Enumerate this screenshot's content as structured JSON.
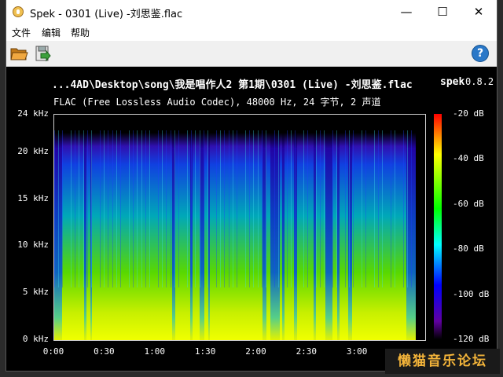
{
  "window": {
    "title": "Spek - 0301 (Live) -刘思鉴.flac",
    "controls": {
      "minimize": "—",
      "maximize": "☐",
      "close": "✕"
    }
  },
  "menu": [
    "文件",
    "编辑",
    "帮助"
  ],
  "toolbar": {
    "open_icon": "folder-open-icon",
    "save_icon": "save-icon",
    "help_label": "?"
  },
  "content": {
    "file_title": "...4AD\\Desktop\\song\\我是唱作人2 第1期\\0301 (Live) -刘思鉴.flac",
    "app_name": "spek",
    "version": "0.8.2",
    "file_info": "FLAC (Free Lossless Audio Codec), 48000 Hz, 24 字节, 2 声道"
  },
  "freq_labels": [
    {
      "label": "24 kHz",
      "value": 24
    },
    {
      "label": "20 kHz",
      "value": 20
    },
    {
      "label": "15 kHz",
      "value": 15
    },
    {
      "label": "10 kHz",
      "value": 10
    },
    {
      "label": "5 kHz",
      "value": 5
    },
    {
      "label": "0 kHz",
      "value": 0
    }
  ],
  "time_labels": [
    {
      "label": "0:00",
      "seconds": 0
    },
    {
      "label": "0:30",
      "seconds": 30
    },
    {
      "label": "1:00",
      "seconds": 60
    },
    {
      "label": "1:30",
      "seconds": 90
    },
    {
      "label": "2:00",
      "seconds": 120
    },
    {
      "label": "2:30",
      "seconds": 150
    },
    {
      "label": "3:00",
      "seconds": 180
    }
  ],
  "time_axis_max_seconds": 220,
  "db_labels": [
    {
      "label": "-20 dB",
      "value": -20
    },
    {
      "label": "-40 dB",
      "value": -40
    },
    {
      "label": "-60 dB",
      "value": -60
    },
    {
      "label": "-80 dB",
      "value": -80
    },
    {
      "label": "-100 dB",
      "value": -100
    },
    {
      "label": "-120 dB",
      "value": -120
    }
  ],
  "overlay": {
    "watermark": "懒猫音乐论坛"
  }
}
